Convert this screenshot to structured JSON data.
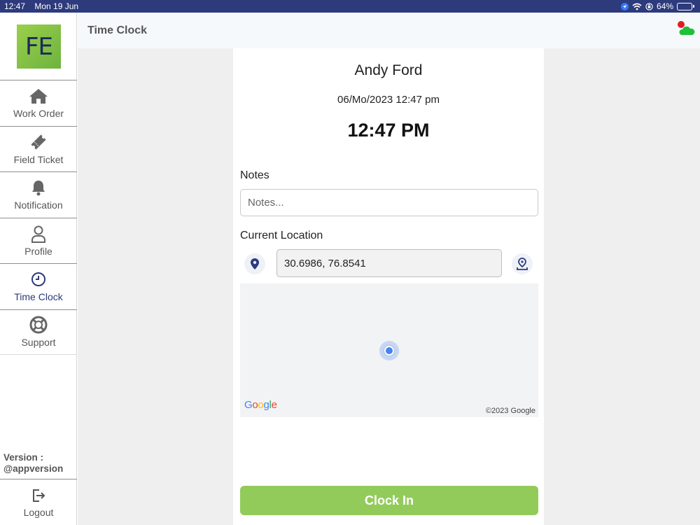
{
  "status_bar": {
    "time": "12:47",
    "date": "Mon 19 Jun",
    "battery": "64%",
    "battery_level": 0.64,
    "icons": [
      "location-arrow-icon",
      "wifi-icon",
      "orientation-lock-icon",
      "battery-charging-icon"
    ]
  },
  "sidebar": {
    "logo_text": "FE",
    "items": [
      {
        "label": "Work Order",
        "icon": "home-icon",
        "active": false
      },
      {
        "label": "Field Ticket",
        "icon": "ticket-icon",
        "active": false
      },
      {
        "label": "Notification",
        "icon": "bell-icon",
        "active": false
      },
      {
        "label": "Profile",
        "icon": "user-icon",
        "active": false
      },
      {
        "label": "Time Clock",
        "icon": "clock-icon",
        "active": true
      },
      {
        "label": "Support",
        "icon": "lifebuoy-icon",
        "active": false
      }
    ],
    "version_label": "Version :",
    "version_value": "@appversion",
    "logout_label": "Logout"
  },
  "header": {
    "title": "Time Clock",
    "status_icon": "cloud-sync-status-icon"
  },
  "timeclock": {
    "user_name": "Andy Ford",
    "date_time": "06/Mo/2023 12:47 pm",
    "current_time": "12:47 PM",
    "notes_label": "Notes",
    "notes_placeholder": "Notes...",
    "notes_value": "",
    "location_label": "Current Location",
    "location_value": "30.6986, 76.8541",
    "map_logo": "Google",
    "map_copyright": "©2023 Google",
    "clock_in_label": "Clock In"
  },
  "colors": {
    "status_bar": "#2d3a7c",
    "active_nav": "#2d3a7c",
    "clock_in_button": "#93cb5b",
    "logo_green": "#8cc63f",
    "header_bg": "#f5f9fc",
    "main_bg": "#efefef"
  }
}
